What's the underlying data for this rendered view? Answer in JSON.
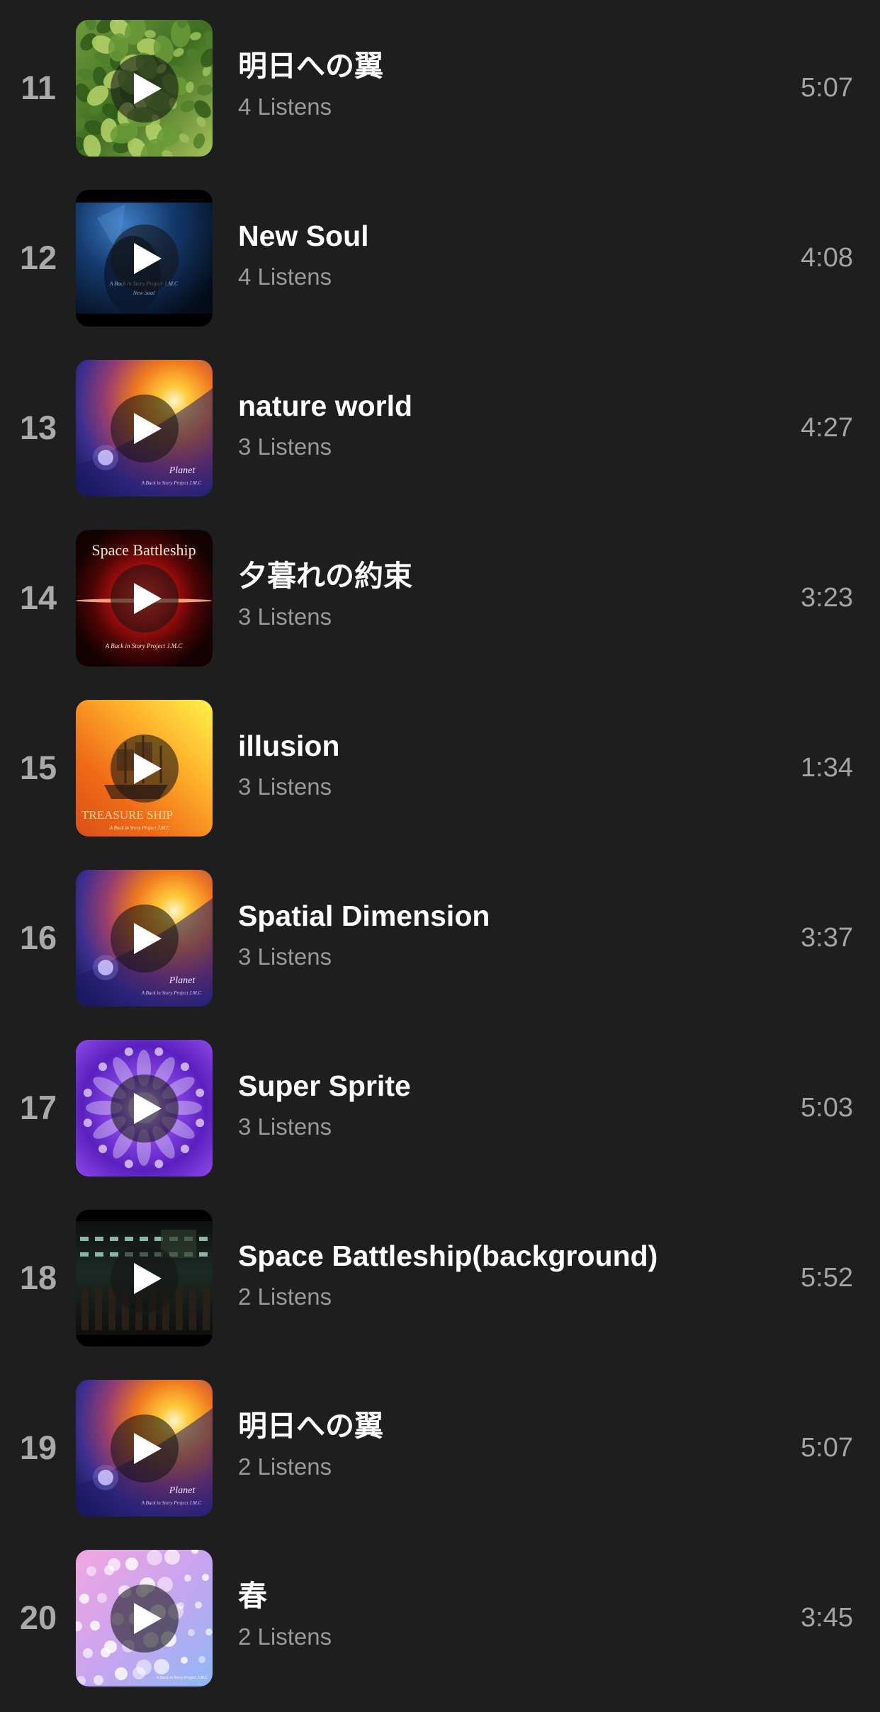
{
  "tracks": [
    {
      "number": "11",
      "title": "明日への翼",
      "listens": "4 Listens",
      "duration": "5:07",
      "artwork": "leaves"
    },
    {
      "number": "12",
      "title": "New Soul",
      "listens": "4 Listens",
      "duration": "4:08",
      "artwork": "dark-blue"
    },
    {
      "number": "13",
      "title": "nature world",
      "listens": "3 Listens",
      "duration": "4:27",
      "artwork": "planet"
    },
    {
      "number": "14",
      "title": "夕暮れの約束",
      "listens": "3 Listens",
      "duration": "3:23",
      "artwork": "space-battleship"
    },
    {
      "number": "15",
      "title": "illusion",
      "listens": "3 Listens",
      "duration": "1:34",
      "artwork": "treasure-ship"
    },
    {
      "number": "16",
      "title": "Spatial Dimension",
      "listens": "3 Listens",
      "duration": "3:37",
      "artwork": "planet"
    },
    {
      "number": "17",
      "title": "Super Sprite",
      "listens": "3 Listens",
      "duration": "5:03",
      "artwork": "kaleidoscope"
    },
    {
      "number": "18",
      "title": "Space Battleship(background)",
      "listens": "2 Listens",
      "duration": "5:52",
      "artwork": "machinery"
    },
    {
      "number": "19",
      "title": "明日への翼",
      "listens": "2 Listens",
      "duration": "5:07",
      "artwork": "planet"
    },
    {
      "number": "20",
      "title": "春",
      "listens": "2 Listens",
      "duration": "3:45",
      "artwork": "cherry-blossom"
    }
  ],
  "artwork_text": {
    "planet_title": "Planet",
    "planet_credit": "A Back in Story Project J.M.C",
    "battleship_title": "Space Battleship",
    "battleship_credit": "A Back in Story Project J.M.C",
    "treasure_title": "TREASURE SHIP",
    "treasure_credit": "A Back in Story Project J.M.C",
    "newsoul_credit": "A Back in Story Project J.M.C",
    "newsoul_title": "New Soul",
    "blossom_credit": "A Back in Story Project J.M.C"
  },
  "icons": {
    "play": "play-icon"
  },
  "colors": {
    "background": "#1e1e1f",
    "title": "#ffffff",
    "secondary": "#9a9a9c"
  }
}
